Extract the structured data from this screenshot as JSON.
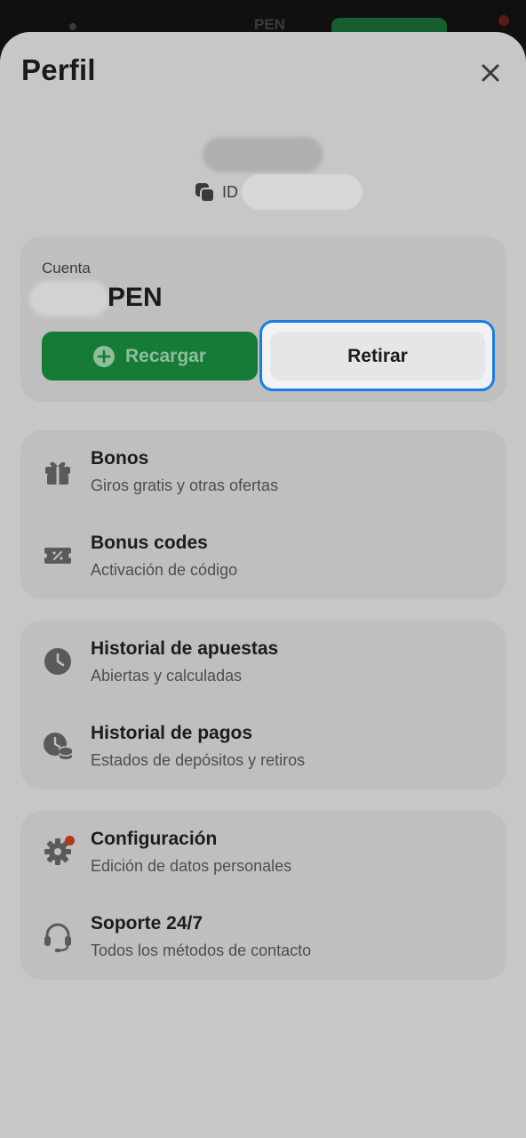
{
  "header": {
    "title": "Perfil"
  },
  "profile": {
    "id_label": "ID"
  },
  "account": {
    "label": "Cuenta",
    "currency": "PEN",
    "deposit_label": "Recargar",
    "withdraw_label": "Retirar"
  },
  "menu_groups": [
    {
      "items": [
        {
          "title": "Bonos",
          "subtitle": "Giros gratis y otras ofertas",
          "icon": "gift-icon"
        },
        {
          "title": "Bonus codes",
          "subtitle": "Activación de código",
          "icon": "coupon-icon"
        }
      ]
    },
    {
      "items": [
        {
          "title": "Historial de apuestas",
          "subtitle": "Abiertas y calculadas",
          "icon": "clock-icon"
        },
        {
          "title": "Historial de pagos",
          "subtitle": "Estados de depósitos y retiros",
          "icon": "payment-history-icon"
        }
      ]
    },
    {
      "items": [
        {
          "title": "Configuración",
          "subtitle": "Edición de datos personales",
          "icon": "gear-icon"
        },
        {
          "title": "Soporte 24/7",
          "subtitle": "Todos los métodos de contacto",
          "icon": "headset-icon"
        }
      ]
    }
  ],
  "colors": {
    "accent_green": "#157b37",
    "focus_blue": "#1a7de5",
    "notification_red": "#b2371d"
  }
}
